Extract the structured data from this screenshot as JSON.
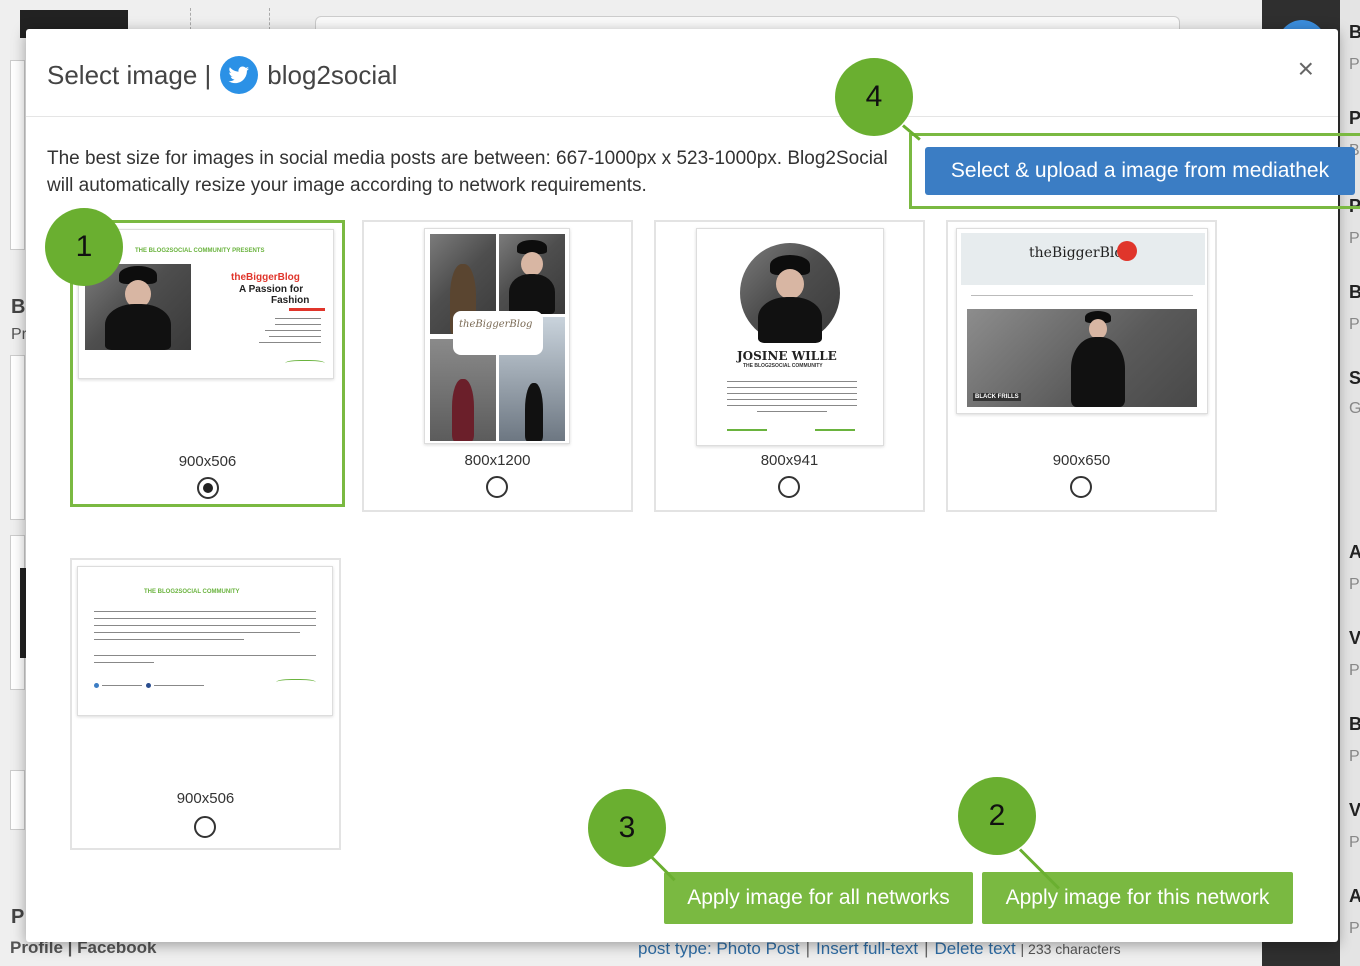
{
  "modal": {
    "title": "Select image |",
    "brand": "blog2social",
    "close_symbol": "×",
    "info_text": "The best size for images in social media posts are between: 667-1000px x 523-1000px. Blog2Social will automatically resize your image according to network requirements.",
    "upload_button": "Select & upload a image from mediathek"
  },
  "images": [
    {
      "size": "900x506",
      "selected": true
    },
    {
      "size": "800x1200",
      "selected": false
    },
    {
      "size": "800x941",
      "selected": false
    },
    {
      "size": "900x650",
      "selected": false
    },
    {
      "size": "900x506",
      "selected": false
    }
  ],
  "thumbnails": {
    "t1_header": "THE BLOG2SOCIAL COMMUNITY PRESENTS",
    "t1_brand": "theBiggerBlog",
    "t1_tagline_1": "A Passion for",
    "t1_tagline_2": "Fashion",
    "t2_brand": "theBiggerBlog",
    "t3_name": "JOSINE WILLE",
    "t3_sub": "THE BLOG2SOCIAL COMMUNITY",
    "t4_brand": "theBiggerBlog",
    "t4_caption": "BLACK FRILLS",
    "t5_header": "THE BLOG2SOCIAL COMMUNITY"
  },
  "actions": {
    "apply_all": "Apply image for all networks",
    "apply_this": "Apply image for this network"
  },
  "callouts": [
    "1",
    "2",
    "3",
    "4"
  ],
  "background": {
    "edge_b": "B",
    "edge_p": "Pr",
    "edge_p2": "P",
    "profile": "Profile | Facebook",
    "footer_post_type": "post type: Photo Post",
    "footer_insert": "Insert full-text",
    "footer_delete": "Delete text",
    "footer_count": "| 233 characters",
    "sidebar_letters": [
      "B",
      "P",
      "P",
      "B",
      "P",
      "P",
      "B",
      "P",
      "S",
      "G",
      "A",
      "P",
      "V",
      "P",
      "B",
      "P",
      "V",
      "P",
      "A",
      "P"
    ]
  },
  "colors": {
    "accent_green": "#7ab941",
    "callout_green": "#6aaf30",
    "upload_blue": "#3b7dc4",
    "brand_red": "#e0352b"
  }
}
